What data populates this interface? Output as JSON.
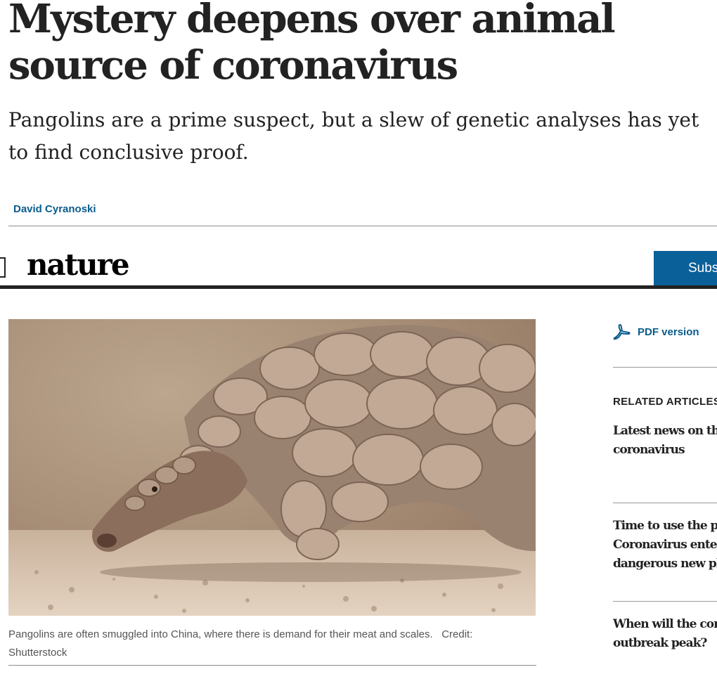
{
  "article": {
    "title": "Mystery deepens over animal source of coronavirus",
    "standfirst": "Pangolins are a prime suspect, but a slew of genetic analyses has yet to find conclusive proof.",
    "author": "David Cyranoski"
  },
  "header": {
    "logo": "nature",
    "subscribe_label": "Subs",
    "brand_color": "#0a6099"
  },
  "figure": {
    "caption": "Pangolins are often smuggled into China, where there is demand for their meat and scales.",
    "credit": "Credit: Shutterstock"
  },
  "sidebar": {
    "pdf_label": "PDF version",
    "pdf_icon": "acrobat-icon",
    "related_heading": "RELATED ARTICLES",
    "related": [
      {
        "lines": [
          "Latest news on the",
          "coronavirus"
        ]
      },
      {
        "lines": [
          "Time to use the p-",
          "Coronavirus enter",
          "dangerous new pl"
        ]
      },
      {
        "lines": [
          "When will the cor",
          "outbreak peak?"
        ]
      }
    ]
  }
}
